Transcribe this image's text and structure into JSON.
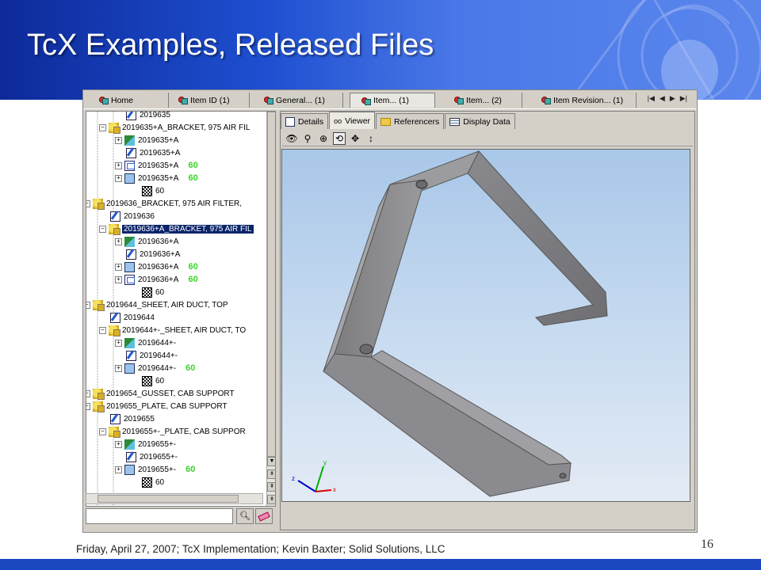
{
  "slide": {
    "title": "TcX Examples, Released Files",
    "footer": "Friday, April 27, 2007; TcX Implementation; Kevin Baxter; Solid Solutions, LLC",
    "page_number": "16",
    "colors": {
      "banner": "#1e4fd0",
      "bottom_bar": "#1c45c0",
      "selection": "#0a246a",
      "status_green": "#3cd32c"
    }
  },
  "top_tabs": [
    {
      "label": "Home",
      "icon": "home-icon"
    },
    {
      "label": "Item ID (1)",
      "icon": "item-query-icon"
    },
    {
      "label": "General... (1)",
      "icon": "item-query-icon"
    },
    {
      "label": "Item... (1)",
      "icon": "item-query-icon"
    },
    {
      "label": "Item... (2)",
      "icon": "item-query-icon"
    },
    {
      "label": "Item Revision... (1)",
      "icon": "item-query-icon"
    }
  ],
  "nav_buttons": {
    "first": "|◀",
    "prev": "◀",
    "next": "▶",
    "last": "▶|"
  },
  "tree": {
    "rows": [
      {
        "label": "2019635",
        "icon": "rev"
      },
      {
        "label": "2019635+A_BRACKET, 975 AIR FIL",
        "icon": "item"
      },
      {
        "label": "2019635+A",
        "icon": "ds"
      },
      {
        "label": "2019635+A",
        "icon": "rev"
      },
      {
        "label": "2019635+A",
        "icon": "drw",
        "status": "60"
      },
      {
        "label": "2019635+A",
        "icon": "model",
        "status": "60"
      },
      {
        "label": "60",
        "icon": "check"
      },
      {
        "label": "2019636_BRACKET, 975 AIR FILTER,",
        "icon": "item"
      },
      {
        "label": "2019636",
        "icon": "rev"
      },
      {
        "label": "2019636+A_BRACKET, 975 AIR FIL",
        "icon": "item",
        "selected": true
      },
      {
        "label": "2019636+A",
        "icon": "ds"
      },
      {
        "label": "2019636+A",
        "icon": "rev"
      },
      {
        "label": "2019636+A",
        "icon": "model",
        "status": "60"
      },
      {
        "label": "2019636+A",
        "icon": "drw",
        "status": "60"
      },
      {
        "label": "60",
        "icon": "check"
      },
      {
        "label": "2019644_SHEET, AIR DUCT, TOP",
        "icon": "item"
      },
      {
        "label": "2019644",
        "icon": "rev"
      },
      {
        "label": "2019644+-_SHEET, AIR DUCT, TO",
        "icon": "item"
      },
      {
        "label": "2019644+-",
        "icon": "ds"
      },
      {
        "label": "2019644+-",
        "icon": "rev"
      },
      {
        "label": "2019644+-",
        "icon": "model",
        "status": "60"
      },
      {
        "label": "60",
        "icon": "check"
      },
      {
        "label": "2019654_GUSSET, CAB SUPPORT",
        "icon": "item"
      },
      {
        "label": "2019655_PLATE, CAB SUPPORT",
        "icon": "item"
      },
      {
        "label": "2019655",
        "icon": "rev"
      },
      {
        "label": "2019655+-_PLATE, CAB SUPPOR",
        "icon": "item"
      },
      {
        "label": "2019655+-",
        "icon": "ds"
      },
      {
        "label": "2019655+-",
        "icon": "rev"
      },
      {
        "label": "2019655+-",
        "icon": "model",
        "status": "60"
      },
      {
        "label": "60",
        "icon": "check"
      }
    ]
  },
  "search": {
    "placeholder": "",
    "value": ""
  },
  "viewer_tabs": [
    {
      "label": "Details",
      "icon": "details-icon"
    },
    {
      "label": "Viewer",
      "icon": "eyeglasses-icon",
      "active": true
    },
    {
      "label": "Referencers",
      "icon": "folder-icon"
    },
    {
      "label": "Display Data",
      "icon": "table-icon"
    }
  ],
  "viewer_tools": [
    "view-eye-icon",
    "zoom-icon",
    "pan-center-icon",
    "rotate-icon",
    "move-icon",
    "vertical-move-icon"
  ],
  "axis_labels": {
    "x": "x",
    "y": "y",
    "z": "z"
  }
}
